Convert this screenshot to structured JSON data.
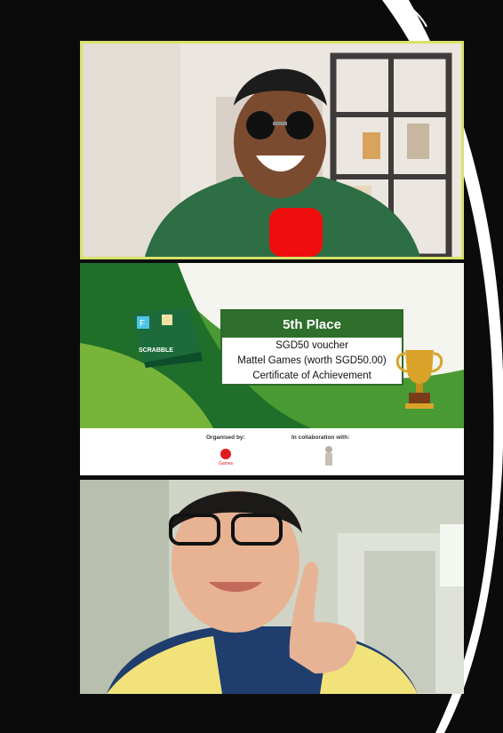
{
  "slide": {
    "place_title": "5th Place",
    "prize_lines": [
      "SGD50 voucher",
      "Mattel Games (worth SGD50.00)",
      "Certificate of Achievement"
    ],
    "organised_label": "Organised by:",
    "collab_label": "In collaboration with:",
    "organiser_logo_text": "Games",
    "scrabble_box_text": "SCRABBLE"
  },
  "colors": {
    "active_speaker_border": "#d7e36a",
    "slide_green": "#2e6f2c",
    "background": "#0b0b0b"
  },
  "icons": {
    "trophy": "trophy-icon",
    "mattel_logo": "mattel-logo"
  }
}
